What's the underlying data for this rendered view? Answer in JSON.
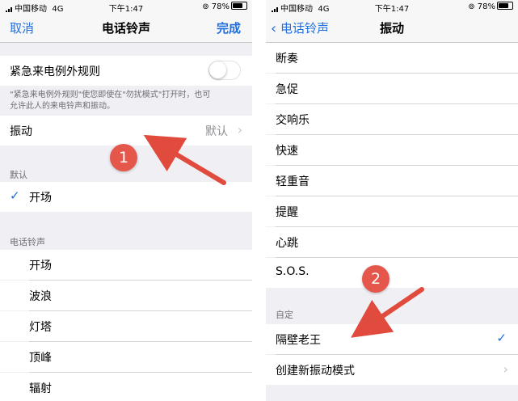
{
  "left": {
    "status": {
      "carrier": "中国移动",
      "network": "4G",
      "time": "下午1:47",
      "battery": "78%"
    },
    "nav": {
      "cancel": "取消",
      "title": "电话铃声",
      "done": "完成"
    },
    "emergency": {
      "label": "紧急来电例外规则",
      "toggle_on": false,
      "footer_line1": "\"紧急来电例外规则\"使您即使在\"勿扰模式\"打开时，也可",
      "footer_line2": "允许此人的来电铃声和振动。"
    },
    "vibration": {
      "label": "振动",
      "value": "默认"
    },
    "default_section": {
      "header": "默认",
      "item": "开场"
    },
    "ringtones": {
      "header": "电话铃声",
      "items": [
        "开场",
        "波浪",
        "灯塔",
        "顶峰",
        "辐射"
      ]
    },
    "badge": "1"
  },
  "right": {
    "status": {
      "carrier": "中国移动",
      "network": "4G",
      "time": "下午1:47",
      "battery": "78%"
    },
    "nav": {
      "back": "电话铃声",
      "title": "振动"
    },
    "patterns": [
      "断奏",
      "急促",
      "交响乐",
      "快速",
      "轻重音",
      "提醒",
      "心跳",
      "S.O.S."
    ],
    "custom": {
      "header": "自定",
      "selected": "隔壁老王",
      "create": "创建新振动模式"
    },
    "badge": "2"
  },
  "colors": {
    "accent": "#1f6fe0",
    "badge": "#e5574b",
    "arrow": "#e04b3d"
  }
}
